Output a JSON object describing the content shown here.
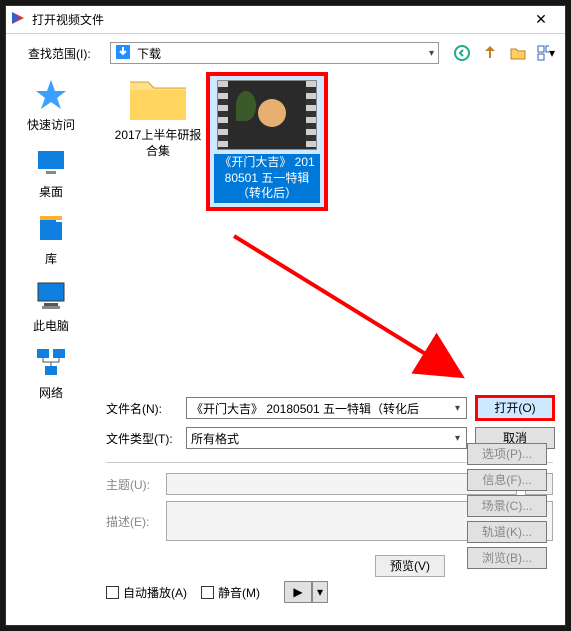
{
  "window": {
    "title": "打开视频文件"
  },
  "lookin": {
    "label": "查找范围(I):",
    "value": "下载"
  },
  "places": {
    "quick": "快速访问",
    "desktop": "桌面",
    "libraries": "库",
    "thispc": "此电脑",
    "network": "网络"
  },
  "items": {
    "folder": "2017上半年研报合集",
    "video": "《开门大吉》 20180501 五一特辑（转化后）"
  },
  "fields": {
    "filename_label": "文件名(N):",
    "filename_value": "《开门大吉》 20180501 五一特辑（转化后",
    "filetype_label": "文件类型(T):",
    "filetype_value": "所有格式",
    "subject_label": "主题(U):",
    "desc_label": "描述(E):"
  },
  "buttons": {
    "open": "打开(O)",
    "cancel": "取消",
    "options": "选项(P)...",
    "info": "信息(F)...",
    "scene": "场景(C)...",
    "track": "轨道(K)...",
    "browse": "浏览(B)...",
    "preview": "预览(V)"
  },
  "checks": {
    "autoplay": "自动播放(A)",
    "mute": "静音(M)"
  }
}
